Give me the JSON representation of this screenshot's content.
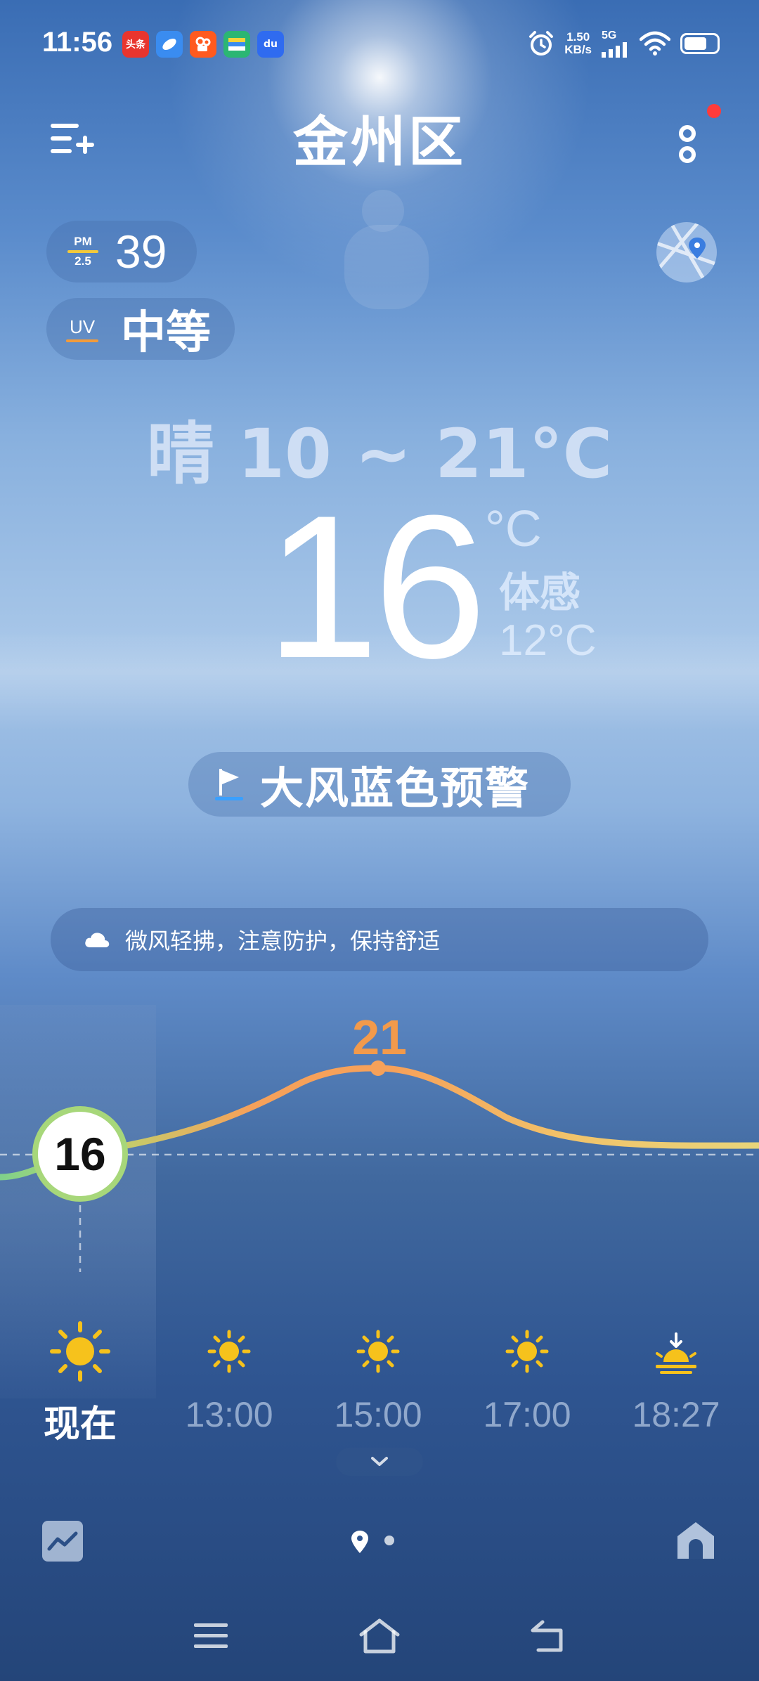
{
  "status_bar": {
    "time": "11:56",
    "apps": [
      {
        "name": "toutiao-app-icon",
        "label": "头条",
        "color": "#e8352e"
      },
      {
        "name": "browser-app-icon",
        "label": "",
        "color": "#3a8cf0"
      },
      {
        "name": "kuaishou-app-icon",
        "label": "",
        "color": "#ff5a1f"
      },
      {
        "name": "wallet-app-icon",
        "label": "",
        "color": "#2bb673"
      },
      {
        "name": "baidu-app-icon",
        "label": "du",
        "color": "#2f6bf0"
      }
    ],
    "net_speed_value": "1.50",
    "net_speed_unit": "KB/s",
    "network_type": "5G",
    "battery_level": 0.7
  },
  "header": {
    "title": "金州区"
  },
  "air_quality": {
    "pm_label_top": "PM",
    "pm_label_bottom": "2.5",
    "pm_value": "39",
    "uv_label": "UV",
    "uv_value": "中等"
  },
  "weather": {
    "forecast": "晴 10 ~ 21°C",
    "current_temp": "16",
    "unit": "°C",
    "feels_like_label": "体感",
    "feels_like_value": "12°C"
  },
  "alert": {
    "text": "大风蓝色预警"
  },
  "tip": {
    "text": "微风轻拂，注意防护，保持舒适"
  },
  "hourly": {
    "current_temp": "16",
    "peak_temp": "21",
    "items": [
      {
        "time": "现在",
        "icon": "sun-icon"
      },
      {
        "time": "13:00",
        "icon": "sun-icon"
      },
      {
        "time": "15:00",
        "icon": "sun-icon"
      },
      {
        "time": "17:00",
        "icon": "sun-icon"
      },
      {
        "time": "18:27",
        "icon": "sunset-icon"
      }
    ]
  },
  "colors": {
    "curve_start": "#7fd08a",
    "curve_mid": "#f6a15a",
    "curve_end": "#e8d57a",
    "sun": "#f6c21c",
    "alert_dot": "#ff3b3b"
  }
}
